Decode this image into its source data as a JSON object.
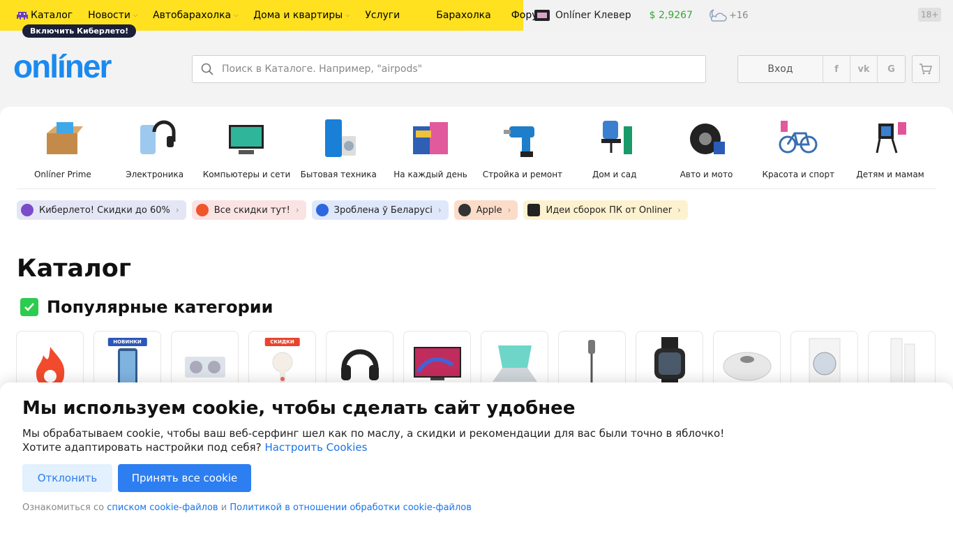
{
  "topnav": {
    "items": [
      {
        "label": "Каталог",
        "dropdown": false
      },
      {
        "label": "Новости",
        "dropdown": true
      },
      {
        "label": "Автобарахолка",
        "dropdown": true
      },
      {
        "label": "Дома и квартиры",
        "dropdown": true
      },
      {
        "label": "Услуги",
        "dropdown": false
      },
      {
        "label": "Барахолка",
        "dropdown": false
      },
      {
        "label": "Форум",
        "dropdown": false
      }
    ],
    "badge": "Включить Киберлето!",
    "klever": "Onlíner Клевер",
    "currency": "$ 2,9267",
    "temperature": "+16",
    "age": "18+"
  },
  "header": {
    "logo": "onlíner",
    "search_placeholder": "Поиск в Каталоге. Например, \"airpods\"",
    "login": "Вход",
    "social": [
      "f",
      "vk",
      "G"
    ]
  },
  "categories": [
    "Onlíner Prime",
    "Электроника",
    "Компьютеры и сети",
    "Бытовая техника",
    "На каждый день",
    "Стройка и ремонт",
    "Дом и сад",
    "Авто и мото",
    "Красота и спорт",
    "Детям и мамам"
  ],
  "chips": [
    {
      "label": "Киберлето! Скидки до 60%",
      "bg": "#e4e6f5"
    },
    {
      "label": "Все скидки тут!",
      "bg": "#fbe3e3"
    },
    {
      "label": "Зроблена ў Беларусі",
      "bg": "#dfe8fb"
    },
    {
      "label": "Apple",
      "bg": "#fbdcc8"
    },
    {
      "label": "Идеи сборок ПК от Onliner",
      "bg": "#fdf2cf"
    }
  ],
  "page_title": "Каталог",
  "popular_title": "Популярные категории",
  "tile_badges": {
    "new": "НОВИНКИ",
    "sale": "СКИДКИ"
  },
  "cookie": {
    "title": "Мы используем cookie, чтобы сделать сайт удобнее",
    "line1": "Мы обрабатываем cookie, чтобы ваш веб-серфинг шел как по маслу, а скидки и рекомендации для вас были точно в яблочко!",
    "line2": "Хотите адаптировать настройки под себя?",
    "configure_link": "Настроить Cookies",
    "decline": "Отклонить",
    "accept": "Принять все cookie",
    "foot_prefix": "Ознакомиться со",
    "foot_link1": "списком cookie-файлов",
    "foot_and": "и",
    "foot_link2": "Политикой в отношении обработки cookie-файлов"
  },
  "colors": {
    "topbar_yellow": "#ffe11f",
    "brand_blue": "#1a8af0",
    "accept_blue": "#2d7ef0",
    "green_check": "#2dcb4f"
  }
}
